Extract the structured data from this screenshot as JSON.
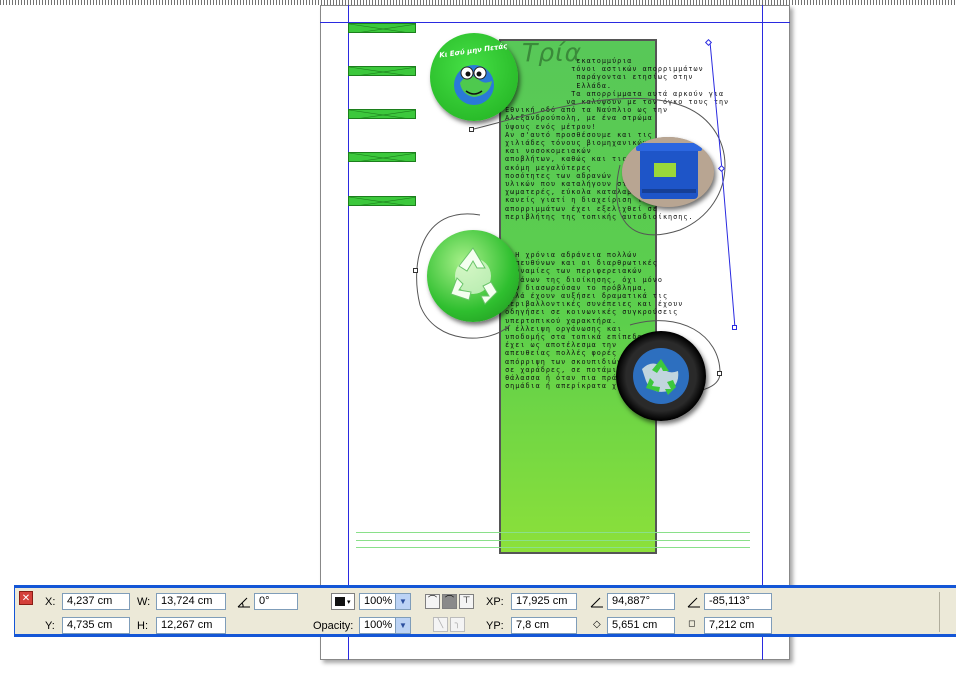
{
  "document": {
    "title": "Τρία",
    "paragraphs": [
      "               εκατομμύρια\n              τόνοι αστικών απορριμμάτων\n               παράγονται ετησίως στην\n               Ελλάδα.\n              Τα απορρίμματα αυτά αρκούν για\n             να καλύψουν με τον όγκο τους την\n Εθνική οδό από τα Ναύπλιο ως την\n Αλεξανδρούπολη, με ένα στρώμα\n ύψους ενός μέτρου!\n Αν σ'αυτό προσθέσουμε και τις\n χιλιάδες τόνους βιομηχανικών\n και νοσοκομειακών\n αποβλήτων, καθώς και τις\n ακόμη μεγαλύτερες\n ποσότητες των αδρανών\n υλικών που καταλήγουν στις\n χωματερές, εύκολα καταλαβαίνει\n κανείς γιατί η διαχείριση των\n απορριμμάτων έχει εξελιχθεί σε\n περιβλήτης της τοπικής αυτοδιοίκησης.",
      "   Η χρόνια αδράνεια πολλών\n  υπευθύνων και οι διαρθρωτικές\n αδυναμίες των περιφερειακών\n οργάνων της διοίκησης, όχι μόνο\n δεν διασωρεύσαν το πρόβλημα,\n αλλά έχουν αυξήσει δραματικά τις\n περιβαλλοντικές συνέπειες και έχουν\n οδηγήσει σε κοινωνικές συγκρούσεις\n υπερτοπικού χαρακτήρα.\n Η έλλειψη οργάνωσης και\n υποδομής στα τοπικά επίπεδα\n έχει ως αποτέλεσμα την\n απευθείας πολλές φορές\n απόρριψη των σκουπιδιών\n σε χαράδρες, σε ποτάμια, στη\n θάλασσα ή όταν πια πράσινα\n σημάδια ή απερίκρατα χώρα."
    ],
    "logo_text": "Κι Εσύ μην Πετάς"
  },
  "icons": {
    "close": "close-icon",
    "fill": "fill-color-icon",
    "angle": "angle-icon",
    "node": "node-icon"
  },
  "toolbar": {
    "x_label": "X:",
    "x_value": "4,237 cm",
    "y_label": "Y:",
    "y_value": "4,735 cm",
    "w_label": "W:",
    "w_value": "13,724 cm",
    "h_label": "H:",
    "h_value": "12,267 cm",
    "rotation_value": "0°",
    "zoom_value": "100%",
    "opacity_label": "Opacity:",
    "opacity_value": "100%",
    "xp_label": "XP:",
    "xp_value": "17,925 cm",
    "yp_label": "YP:",
    "yp_value": "7,8 cm",
    "angle1_value": "94,887°",
    "angle2_value": "-85,113°",
    "len1_value": "5,651 cm",
    "len2_value": "7,212 cm"
  },
  "colors": {
    "accent": "#1456d6",
    "guide": "#2a2ae0",
    "column_green": "#5ccf4c",
    "box_green": "#3cc83c"
  }
}
